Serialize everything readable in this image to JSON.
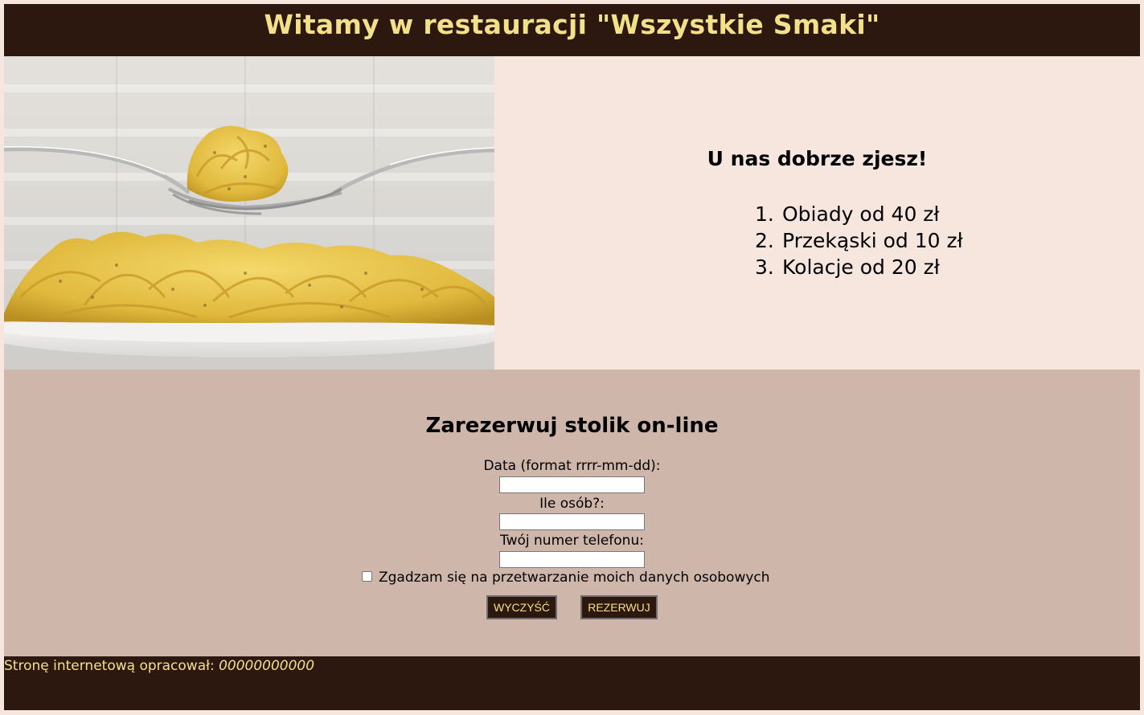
{
  "header": {
    "title": "Witamy w restauracji \"Wszystkie Smaki\""
  },
  "hero": {
    "image_subject": "pasta-on-fork-photo",
    "heading": "U nas dobrze zjesz!",
    "menu_items": [
      {
        "num": "1.",
        "label": "Obiady od 40 zł"
      },
      {
        "num": "2.",
        "label": "Przekąski od 10 zł"
      },
      {
        "num": "3.",
        "label": "Kolacje od 20 zł"
      }
    ]
  },
  "reservation": {
    "heading": "Zarezerwuj stolik on-line",
    "date_label": "Data (format rrrr-mm-dd):",
    "date_value": "",
    "people_label": "Ile osób?:",
    "people_value": "",
    "phone_label": "Twój numer telefonu:",
    "phone_value": "",
    "consent_label": "Zgadzam się na przetwarzanie moich danych osobowych",
    "consent_checked": false,
    "clear_button": "WYCZYŚĆ",
    "reserve_button": "REZERWUJ"
  },
  "footer": {
    "prefix": "Stronę internetową opracował: ",
    "author": "00000000000"
  },
  "colors": {
    "dark_brown": "#2c180e",
    "gold_text": "#f2e08a",
    "light_pink_bg": "#f6e6de",
    "form_bg": "#cfb6aa"
  }
}
